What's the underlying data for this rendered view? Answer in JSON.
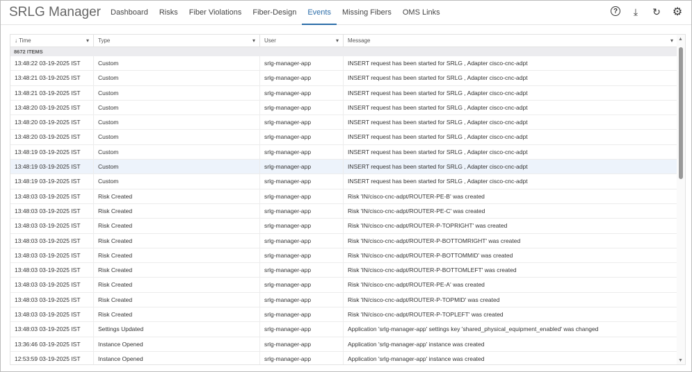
{
  "app": {
    "title": "SRLG Manager"
  },
  "nav": [
    {
      "label": "Dashboard"
    },
    {
      "label": "Risks"
    },
    {
      "label": "Fiber Violations"
    },
    {
      "label": "Fiber-Design"
    },
    {
      "label": "Events",
      "active": true
    },
    {
      "label": "Missing Fibers"
    },
    {
      "label": "OMS Links"
    }
  ],
  "toolbar": {
    "help": "?",
    "download": "⤓",
    "refresh": "↻",
    "settings": "⚙"
  },
  "table": {
    "columns": [
      {
        "label": "Time",
        "sort": "↓"
      },
      {
        "label": "Type"
      },
      {
        "label": "User"
      },
      {
        "label": "Message"
      }
    ],
    "count": "8672 ITEMS",
    "rows": [
      [
        "13:48:22 03-19-2025 IST",
        "Custom",
        "srlg-manager-app",
        "INSERT request has been started for SRLG , Adapter cisco-cnc-adpt"
      ],
      [
        "13:48:21 03-19-2025 IST",
        "Custom",
        "srlg-manager-app",
        "INSERT request has been started for SRLG , Adapter cisco-cnc-adpt"
      ],
      [
        "13:48:21 03-19-2025 IST",
        "Custom",
        "srlg-manager-app",
        "INSERT request has been started for SRLG , Adapter cisco-cnc-adpt"
      ],
      [
        "13:48:20 03-19-2025 IST",
        "Custom",
        "srlg-manager-app",
        "INSERT request has been started for SRLG , Adapter cisco-cnc-adpt"
      ],
      [
        "13:48:20 03-19-2025 IST",
        "Custom",
        "srlg-manager-app",
        "INSERT request has been started for SRLG , Adapter cisco-cnc-adpt"
      ],
      [
        "13:48:20 03-19-2025 IST",
        "Custom",
        "srlg-manager-app",
        "INSERT request has been started for SRLG , Adapter cisco-cnc-adpt"
      ],
      [
        "13:48:19 03-19-2025 IST",
        "Custom",
        "srlg-manager-app",
        "INSERT request has been started for SRLG , Adapter cisco-cnc-adpt"
      ],
      [
        "13:48:19 03-19-2025 IST",
        "Custom",
        "srlg-manager-app",
        "INSERT request has been started for SRLG , Adapter cisco-cnc-adpt"
      ],
      [
        "13:48:19 03-19-2025 IST",
        "Custom",
        "srlg-manager-app",
        "INSERT request has been started for SRLG , Adapter cisco-cnc-adpt"
      ],
      [
        "13:48:03 03-19-2025 IST",
        "Risk Created",
        "srlg-manager-app",
        "Risk 'IN/cisco-cnc-adpt/ROUTER-PE-B' was created"
      ],
      [
        "13:48:03 03-19-2025 IST",
        "Risk Created",
        "srlg-manager-app",
        "Risk 'IN/cisco-cnc-adpt/ROUTER-PE-C' was created"
      ],
      [
        "13:48:03 03-19-2025 IST",
        "Risk Created",
        "srlg-manager-app",
        "Risk 'IN/cisco-cnc-adpt/ROUTER-P-TOPRIGHT' was created"
      ],
      [
        "13:48:03 03-19-2025 IST",
        "Risk Created",
        "srlg-manager-app",
        "Risk 'IN/cisco-cnc-adpt/ROUTER-P-BOTTOMRIGHT' was created"
      ],
      [
        "13:48:03 03-19-2025 IST",
        "Risk Created",
        "srlg-manager-app",
        "Risk 'IN/cisco-cnc-adpt/ROUTER-P-BOTTOMMID' was created"
      ],
      [
        "13:48:03 03-19-2025 IST",
        "Risk Created",
        "srlg-manager-app",
        "Risk 'IN/cisco-cnc-adpt/ROUTER-P-BOTTOMLEFT' was created"
      ],
      [
        "13:48:03 03-19-2025 IST",
        "Risk Created",
        "srlg-manager-app",
        "Risk 'IN/cisco-cnc-adpt/ROUTER-PE-A' was created"
      ],
      [
        "13:48:03 03-19-2025 IST",
        "Risk Created",
        "srlg-manager-app",
        "Risk 'IN/cisco-cnc-adpt/ROUTER-P-TOPMID' was created"
      ],
      [
        "13:48:03 03-19-2025 IST",
        "Risk Created",
        "srlg-manager-app",
        "Risk 'IN/cisco-cnc-adpt/ROUTER-P-TOPLEFT' was created"
      ],
      [
        "13:48:03 03-19-2025 IST",
        "Settings Updated",
        "srlg-manager-app",
        "Application 'srlg-manager-app' settings key 'shared_physical_equipment_enabled' was changed"
      ],
      [
        "13:36:46 03-19-2025 IST",
        "Instance Opened",
        "srlg-manager-app",
        "Application 'srlg-manager-app' instance was created"
      ],
      [
        "12:53:59 03-19-2025 IST",
        "Instance Opened",
        "srlg-manager-app",
        "Application 'srlg-manager-app' instance was created"
      ]
    ]
  }
}
